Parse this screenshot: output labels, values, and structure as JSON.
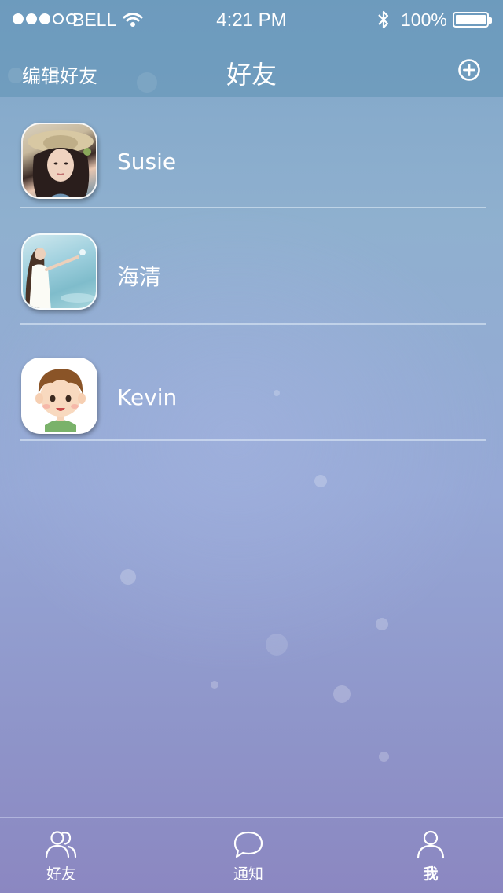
{
  "status_bar": {
    "carrier": "BELL",
    "time": "4:21 PM",
    "battery": "100%",
    "signal_bars_filled": 3,
    "signal_bars_total": 5
  },
  "nav": {
    "left_label": "编辑好友",
    "title": "好友",
    "add_icon": "plus-circle-icon"
  },
  "friends": [
    {
      "name": "Susie",
      "avatar": "photo-avatar"
    },
    {
      "name": "海清",
      "avatar": "photo-avatar"
    },
    {
      "name": "Kevin",
      "avatar": "cartoon-avatar"
    }
  ],
  "tabs": [
    {
      "label": "好友",
      "icon": "friends-icon"
    },
    {
      "label": "通知",
      "icon": "chat-bubble-icon"
    },
    {
      "label": "我",
      "icon": "person-icon",
      "active": true
    }
  ],
  "colors": {
    "text": "#ffffff",
    "bar_overlay": "#5f91b4",
    "background_top": "#7fa6c8",
    "background_bottom": "#8b87c1"
  }
}
